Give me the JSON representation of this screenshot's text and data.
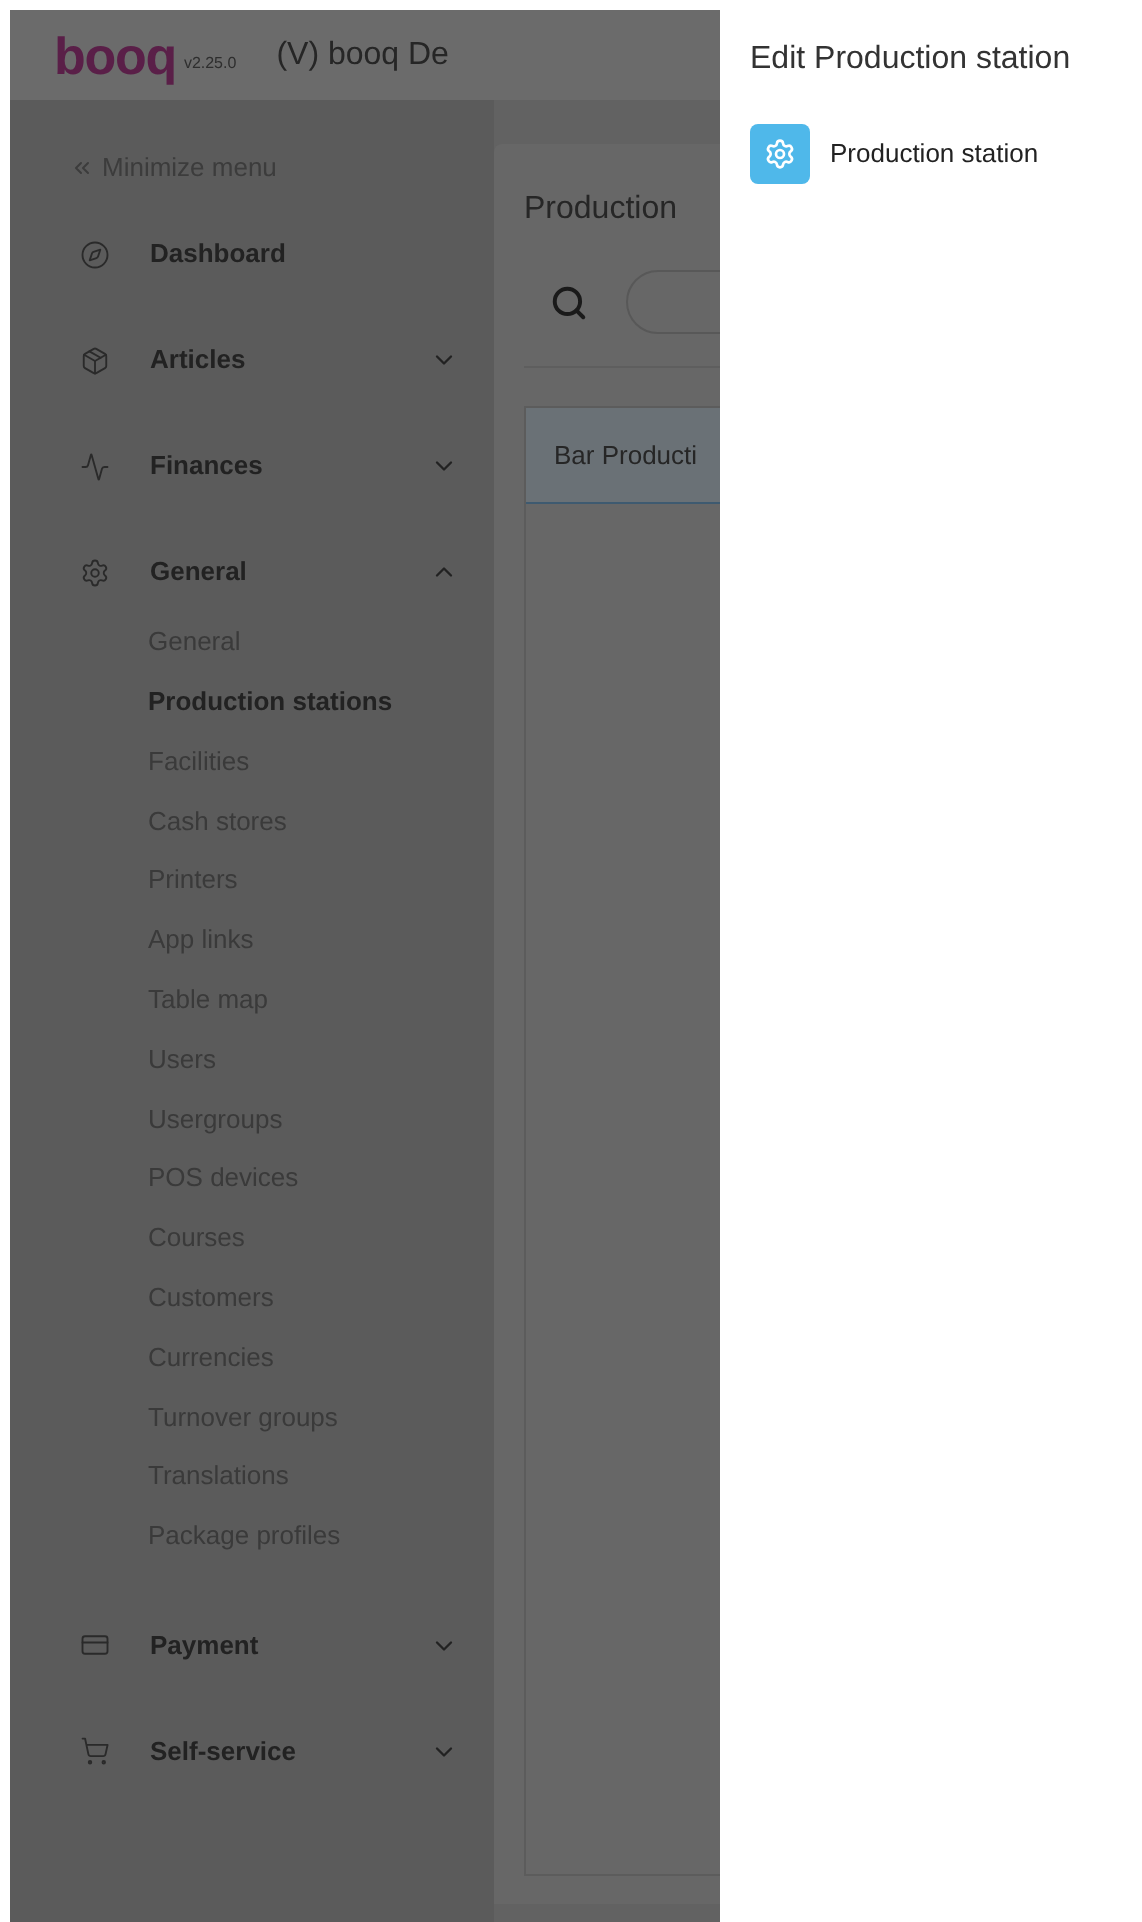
{
  "header": {
    "logo": "booq",
    "version": "v2.25.0",
    "title": "(V) booq De"
  },
  "sidebar": {
    "minimize": "Minimize menu",
    "items": [
      {
        "label": "Dashboard",
        "kind": "link"
      },
      {
        "label": "Articles",
        "kind": "section",
        "expanded": false
      },
      {
        "label": "Finances",
        "kind": "section",
        "expanded": false
      },
      {
        "label": "General",
        "kind": "section",
        "expanded": true,
        "children": [
          {
            "label": "General",
            "selected": false
          },
          {
            "label": "Production stations",
            "selected": true
          },
          {
            "label": "Facilities",
            "selected": false
          },
          {
            "label": "Cash stores",
            "selected": false
          },
          {
            "label": "Printers",
            "selected": false
          },
          {
            "label": "App links",
            "selected": false
          },
          {
            "label": "Table map",
            "selected": false
          },
          {
            "label": "Users",
            "selected": false
          },
          {
            "label": "Usergroups",
            "selected": false
          },
          {
            "label": "POS devices",
            "selected": false
          },
          {
            "label": "Courses",
            "selected": false
          },
          {
            "label": "Customers",
            "selected": false
          },
          {
            "label": "Currencies",
            "selected": false
          },
          {
            "label": "Turnover groups",
            "selected": false
          },
          {
            "label": "Translations",
            "selected": false
          },
          {
            "label": "Package profiles",
            "selected": false
          }
        ]
      },
      {
        "label": "Payment",
        "kind": "section",
        "expanded": false
      },
      {
        "label": "Self-service",
        "kind": "section",
        "expanded": false
      }
    ]
  },
  "main": {
    "title": "Production",
    "table": {
      "rows": [
        "Bar Producti"
      ]
    }
  },
  "drawer": {
    "title": "Edit Production station",
    "items": [
      "Production station"
    ]
  }
}
